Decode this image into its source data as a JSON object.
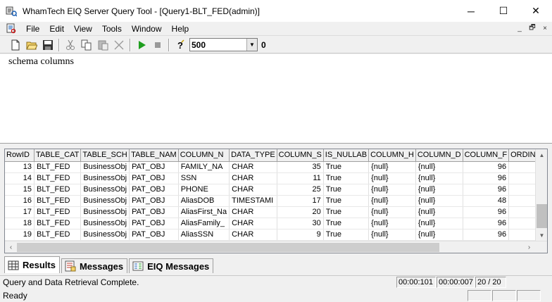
{
  "window": {
    "title": "WhamTech EIQ Server Query Tool - [Query1-BLT_FED(admin)]",
    "minimize": "─",
    "maximize": "☐",
    "close": "✕"
  },
  "menu": {
    "items": [
      "File",
      "Edit",
      "View",
      "Tools",
      "Window",
      "Help"
    ],
    "mdi_minimize": "_",
    "mdi_restore": "🗗",
    "mdi_close": "×"
  },
  "toolbar": {
    "row_limit": "500",
    "row_count": "0"
  },
  "editor": {
    "query_text": "schema columns"
  },
  "grid": {
    "columns": [
      "RowID",
      "TABLE_CAT",
      "TABLE_SCH",
      "TABLE_NAM",
      "COLUMN_N",
      "DATA_TYPE",
      "COLUMN_S",
      "IS_NULLAB",
      "COLUMN_H",
      "COLUMN_D",
      "COLUMN_F",
      "ORDINAL"
    ],
    "rows": [
      [
        "13",
        "BLT_FED",
        "BusinessObj",
        "PAT_OBJ",
        "FAMILY_NA",
        "CHAR",
        "35",
        "True",
        "{null}",
        "{null}",
        "96",
        ""
      ],
      [
        "14",
        "BLT_FED",
        "BusinessObj",
        "PAT_OBJ",
        "SSN",
        "CHAR",
        "11",
        "True",
        "{null}",
        "{null}",
        "96",
        ""
      ],
      [
        "15",
        "BLT_FED",
        "BusinessObj",
        "PAT_OBJ",
        "PHONE",
        "CHAR",
        "25",
        "True",
        "{null}",
        "{null}",
        "96",
        ""
      ],
      [
        "16",
        "BLT_FED",
        "BusinessObj",
        "PAT_OBJ",
        "AliasDOB",
        "TIMESTAMI",
        "17",
        "True",
        "{null}",
        "{null}",
        "48",
        ""
      ],
      [
        "17",
        "BLT_FED",
        "BusinessObj",
        "PAT_OBJ",
        "AliasFirst_Na",
        "CHAR",
        "20",
        "True",
        "{null}",
        "{null}",
        "96",
        ""
      ],
      [
        "18",
        "BLT_FED",
        "BusinessObj",
        "PAT_OBJ",
        "AliasFamily_",
        "CHAR",
        "30",
        "True",
        "{null}",
        "{null}",
        "96",
        ""
      ],
      [
        "19",
        "BLT_FED",
        "BusinessObj",
        "PAT_OBJ",
        "AliasSSN",
        "CHAR",
        "9",
        "True",
        "{null}",
        "{null}",
        "96",
        ""
      ]
    ]
  },
  "tabs": [
    {
      "label": "Results",
      "icon": "grid-icon"
    },
    {
      "label": "Messages",
      "icon": "messages-icon"
    },
    {
      "label": "EIQ Messages",
      "icon": "eiq-messages-icon"
    }
  ],
  "status": {
    "message": "Query and Data Retrieval Complete.",
    "elapsed_total": "00:00:101",
    "elapsed_fetch": "00:00:007",
    "rows": "20 / 20",
    "ready": "Ready"
  }
}
